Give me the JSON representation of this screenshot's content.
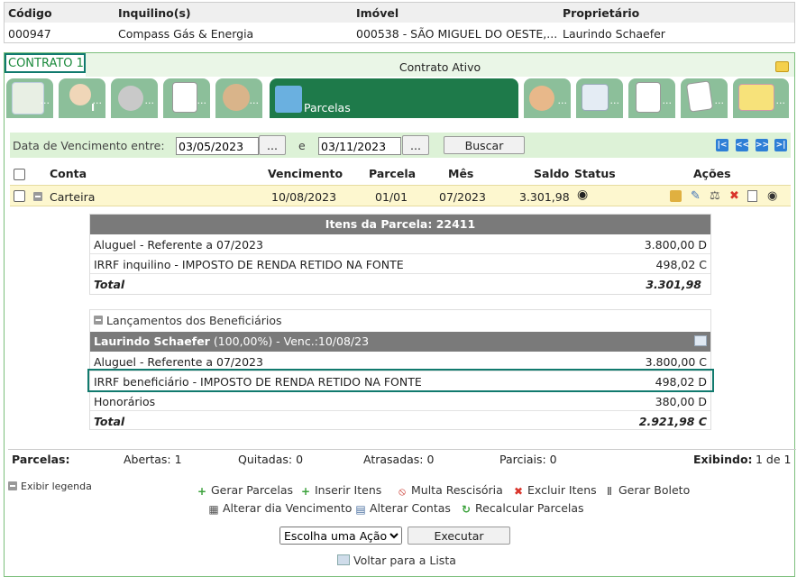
{
  "header": {
    "cols": [
      "Código",
      "Inquilino(s)",
      "Imóvel",
      "Proprietário"
    ],
    "values": [
      "000947",
      "Compass Gás & Energia",
      "000538 - SÃO MIGUEL DO OESTE,...",
      "Laurindo Schaefer"
    ]
  },
  "contract": {
    "title": "CONTRATO 1",
    "status": "Contrato Ativo"
  },
  "tabs": {
    "dots": "...",
    "person_suffix": "I",
    "active_label": "Parcelas"
  },
  "filter": {
    "label": "Data de Vencimento entre:",
    "from": "03/05/2023",
    "to": "03/11/2023",
    "and": "e",
    "dots_button": "...",
    "search_button": "Buscar"
  },
  "table": {
    "columns": {
      "conta": "Conta",
      "vencimento": "Vencimento",
      "parcela": "Parcela",
      "mes": "Mês",
      "saldo": "Saldo",
      "status": "Status",
      "acoes": "Ações"
    },
    "row": {
      "conta": "Carteira",
      "vencimento": "10/08/2023",
      "parcela": "01/01",
      "mes": "07/2023",
      "saldo": "3.301,98"
    }
  },
  "items": {
    "header": "Itens da Parcela: 22411",
    "rows": [
      {
        "desc": "Aluguel - Referente a 07/2023",
        "value": "3.800,00 D"
      },
      {
        "desc": "IRRF inquilino - IMPOSTO DE RENDA RETIDO NA FONTE",
        "value": "498,02 C"
      }
    ],
    "total_label": "Total",
    "total_value": "3.301,98"
  },
  "beneficiaries": {
    "title": "Lançamentos dos Beneficiários",
    "name": "Laurindo Schaefer",
    "detail": "(100,00%) - Venc.:10/08/23",
    "rows": [
      {
        "desc": "Aluguel - Referente a 07/2023",
        "value": "3.800,00 C"
      },
      {
        "desc": "IRRF beneficiário - IMPOSTO DE RENDA RETIDO NA FONTE",
        "value": "498,02 D"
      },
      {
        "desc": "Honorários",
        "value": "380,00 D"
      }
    ],
    "total_label": "Total",
    "total_value": "2.921,98 C"
  },
  "summary": {
    "parcelas": "Parcelas:",
    "abertas": "Abertas: 1",
    "quitadas": "Quitadas: 0",
    "atrasadas": "Atrasadas: 0",
    "parciais": "Parciais: 0",
    "exibindo_label": "Exibindo:",
    "exibindo_value": "1 de 1"
  },
  "actions": {
    "legend": "Exibir legenda",
    "gerar_parcelas": "Gerar Parcelas",
    "inserir_itens": "Inserir Itens",
    "multa": "Multa Rescisória",
    "excluir": "Excluir Itens",
    "boleto": "Gerar Boleto",
    "alterar_dia": "Alterar dia Vencimento",
    "alterar_contas": "Alterar Contas",
    "recalcular": "Recalcular Parcelas",
    "select_value": "Escolha uma Ação",
    "executar": "Executar",
    "voltar": "Voltar para a Lista"
  }
}
